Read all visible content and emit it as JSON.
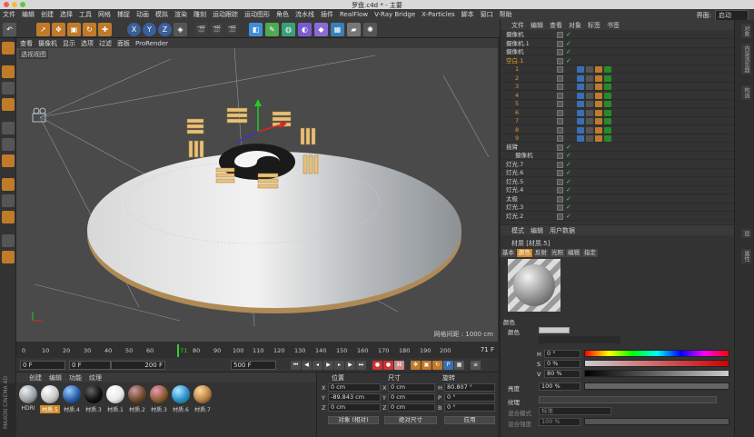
{
  "window": {
    "title": "罗盘.c4d * - 主要"
  },
  "menubar": {
    "items": [
      "文件",
      "编辑",
      "创建",
      "选择",
      "工具",
      "网格",
      "捕捉",
      "动画",
      "模拟",
      "渲染",
      "雕刻",
      "运动跟踪",
      "运动图形",
      "角色",
      "流水线",
      "插件",
      "RealFlow",
      "V-Ray Bridge",
      "X-Particles",
      "脚本",
      "窗口",
      "帮助"
    ],
    "layout_label": "界面:",
    "layout_value": "启动"
  },
  "viewport": {
    "menu": [
      "查看",
      "摄像机",
      "显示",
      "选项",
      "过滤",
      "面板",
      "ProRender"
    ],
    "label": "透视视图",
    "grid_spacing": "网格间距 : 1000 cm"
  },
  "timeline": {
    "ticks": [
      "0",
      "10",
      "20",
      "30",
      "40",
      "50",
      "60",
      "71",
      "80",
      "90",
      "100",
      "110",
      "120",
      "130",
      "140",
      "150",
      "160",
      "170",
      "180",
      "190",
      "200"
    ],
    "current_frame": "71 F",
    "start": "0 F",
    "in_point": "0 F",
    "out_label": "200 F",
    "end": "500 F"
  },
  "material_manager": {
    "menu": [
      "创建",
      "编辑",
      "功能",
      "纹理"
    ],
    "materials": [
      {
        "name": "HDRI",
        "color": "#9aa2a8"
      },
      {
        "name": "材质.5",
        "color": "#c9c9c9"
      },
      {
        "name": "材质.4",
        "color": "#2b5fa8"
      },
      {
        "name": "材质.3",
        "color": "#121212"
      },
      {
        "name": "材质.1",
        "color": "#e8e8e8"
      },
      {
        "name": "材质.2",
        "color": "#6e4b2a"
      },
      {
        "name": "材质.3",
        "color": "#8a5c30"
      },
      {
        "name": "材质.6",
        "color": "#2c8ecf"
      },
      {
        "name": "材质.7",
        "color": "#b78246"
      }
    ]
  },
  "coordinates": {
    "headers": [
      "位置",
      "尺寸",
      "旋转"
    ],
    "rows": [
      {
        "axis": "X",
        "pos": "0 cm",
        "size": "0 cm",
        "rot_label": "H",
        "rot": "80.807 °"
      },
      {
        "axis": "Y",
        "pos": "-89.843 cm",
        "size": "0 cm",
        "rot_label": "P",
        "rot": "0 °"
      },
      {
        "axis": "Z",
        "pos": "0 cm",
        "size": "0 cm",
        "rot_label": "B",
        "rot": "0 °"
      }
    ],
    "mode_object": "对象 (相对)",
    "mode_size": "绝对尺寸",
    "apply": "应用"
  },
  "object_manager": {
    "menu": [
      "文件",
      "编辑",
      "查看",
      "对象",
      "标签",
      "书签"
    ],
    "objects": [
      {
        "name": "摄像机",
        "indent": 0
      },
      {
        "name": "摄像机.1",
        "indent": 0
      },
      {
        "name": "摄像机",
        "indent": 0
      },
      {
        "name": "空白.1",
        "indent": 0,
        "highlight": true
      },
      {
        "name": "1",
        "indent": 1,
        "orange": true
      },
      {
        "name": "2",
        "indent": 1,
        "orange": true
      },
      {
        "name": "3",
        "indent": 1,
        "orange": true
      },
      {
        "name": "4",
        "indent": 1,
        "orange": true
      },
      {
        "name": "5",
        "indent": 1,
        "orange": true
      },
      {
        "name": "6",
        "indent": 1,
        "orange": true
      },
      {
        "name": "7",
        "indent": 1,
        "orange": true
      },
      {
        "name": "8",
        "indent": 1,
        "orange": true
      },
      {
        "name": "9",
        "indent": 1,
        "orange": true
      },
      {
        "name": "摇臂",
        "indent": 0
      },
      {
        "name": "摄像机",
        "indent": 1
      },
      {
        "name": "灯光.7",
        "indent": 0
      },
      {
        "name": "灯光.6",
        "indent": 0
      },
      {
        "name": "灯光.5",
        "indent": 0
      },
      {
        "name": "灯光.4",
        "indent": 0
      },
      {
        "name": "太极",
        "indent": 0
      },
      {
        "name": "灯光.3",
        "indent": 0
      },
      {
        "name": "灯光.2",
        "indent": 0
      }
    ]
  },
  "attribute_manager": {
    "menu": [
      "模式",
      "编辑",
      "用户数据"
    ],
    "title": "材质 [材质.5]",
    "tabs": [
      "基本",
      "颜色",
      "反射",
      "光照",
      "编辑",
      "指定"
    ],
    "active_tab": "颜色",
    "section": "颜色",
    "color_label": "颜色",
    "h_value": "0 °",
    "s_value": "0 %",
    "v_value": "80 %",
    "brightness_label": "亮度",
    "brightness_value": "100 %",
    "texture_label": "纹理",
    "mix_mode_label": "混合模式",
    "mix_mode_value": "标准",
    "mix_strength_label": "混合强度",
    "mix_strength_value": "100 %"
  },
  "side_tabs": [
    "对象",
    "内容浏览器",
    "构造",
    "层",
    "属性"
  ],
  "brand": "MAXON CINEMA 4D"
}
